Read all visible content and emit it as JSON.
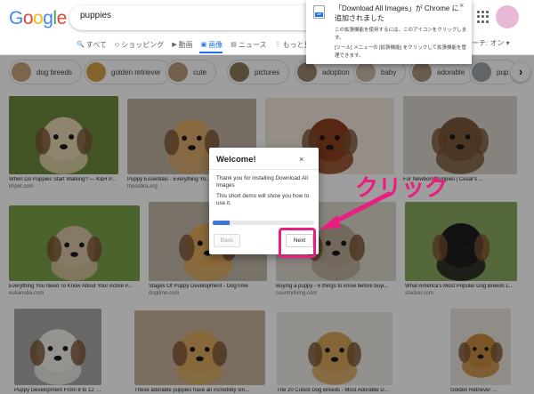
{
  "header": {
    "logo_letters": [
      {
        "char": "G",
        "color": "#4285f4"
      },
      {
        "char": "o",
        "color": "#ea4335"
      },
      {
        "char": "o",
        "color": "#fbbc05"
      },
      {
        "char": "g",
        "color": "#4285f4"
      },
      {
        "char": "l",
        "color": "#34a853"
      },
      {
        "char": "e",
        "color": "#ea4335"
      }
    ],
    "search_query": "puppies",
    "tabs": [
      {
        "icon": "search-icon",
        "glyph": "🔍",
        "label": "すべて"
      },
      {
        "icon": "tag-icon",
        "glyph": "◇",
        "label": "ショッピング"
      },
      {
        "icon": "video-icon",
        "glyph": "▶",
        "label": "動画"
      },
      {
        "icon": "image-icon",
        "glyph": "▣",
        "label": "画像"
      },
      {
        "icon": "news-icon",
        "glyph": "▤",
        "label": "ニュース"
      },
      {
        "icon": "more-icon",
        "glyph": "⋮",
        "label": "もっと見"
      }
    ],
    "active_tab_index": 3,
    "safesearch_label": "フサーチ: オン ▾"
  },
  "chips": [
    {
      "label": "dog breeds",
      "color": "#c8a47c"
    },
    {
      "label": "golden retriever",
      "color": "#d4a24a"
    },
    {
      "label": "cute",
      "color": "#b89a7c"
    },
    {
      "label": "pictures",
      "color": "#8f7a5e"
    },
    {
      "label": "adoption",
      "color": "#9c8670"
    },
    {
      "label": "baby",
      "color": "#c9b8a6"
    },
    {
      "label": "adorable",
      "color": "#a99580"
    },
    {
      "label": "pup",
      "color": "#9aa3a8"
    }
  ],
  "chip_next_glyph": "›",
  "results": [
    {
      "title": "When Do Puppies Start Walking? — K&H P...",
      "source": "khpet.com",
      "bg": "#6f8a3c",
      "fg": "#e7d6b2"
    },
    {
      "title": "Puppy Essentials - Everything Yo...",
      "source": "thesebra.org",
      "bg": "#bfb2a0",
      "fg": "#d9a86a"
    },
    {
      "title": "ly illnesses",
      "source": "",
      "bg": "#efe6da",
      "fg": "#8b3f1e"
    },
    {
      "title": "For Newborn Puppies | Cesar's ...",
      "source": "",
      "bg": "#d8d3cc",
      "fg": "#7a5a3a"
    },
    {
      "title": "Everything You Need To Know About Your Active P...",
      "source": "eukanuba.com",
      "bg": "#7aa04a",
      "fg": "#d9c4a4"
    },
    {
      "title": "Stages Of Puppy Development - DogTime",
      "source": "dogtime.com",
      "bg": "#c2b9a8",
      "fg": "#e0a85a"
    },
    {
      "title": "Buying a puppy - 6 things to know before buyi...",
      "source": "countryliving.com",
      "bg": "#dcd6cc",
      "fg": "#b9aa95"
    },
    {
      "title": "What America's Most Popular Dog Breeds L...",
      "source": "stacker.com",
      "bg": "#8aa860",
      "fg": "#1e1e1e"
    },
    {
      "title": "Puppy Development From 8 to 12 Weeks",
      "source": "",
      "bg": "#a6a8a6",
      "fg": "#f0efe8"
    },
    {
      "title": "These adorable puppies have an incredibly sm...",
      "source": "",
      "bg": "#c8b29a",
      "fg": "#d8a95e"
    },
    {
      "title": "The 20 Cutest Dog Breeds - Most Adorable Dogs...",
      "source": "",
      "bg": "#ece8e2",
      "fg": "#d6a35a"
    },
    {
      "title": "Golden Retriever ...",
      "source": "",
      "bg": "#e8e2da",
      "fg": "#c68a3c"
    }
  ],
  "chrome_notification": {
    "title": "「Download All Images」が Chrome に追加されました",
    "body1": "この拡張機能を使用するには、このアイコンをクリックします。",
    "body2": "[ツール] メニューの [拡張機能] をクリックして拡張機能を管理できます。",
    "icon_label": "ZIP",
    "close_glyph": "×"
  },
  "modal": {
    "title": "Welcome!",
    "close_glyph": "×",
    "text1": "Thank you for installing Download All Images",
    "text2": "This short demo will show you how to use it.",
    "progress_fraction": 0.17,
    "progress_color": "#3b78d8",
    "back_label": "Back",
    "next_label": "Next"
  },
  "annotation": {
    "label": "クリック",
    "color": "#e91e7f"
  }
}
